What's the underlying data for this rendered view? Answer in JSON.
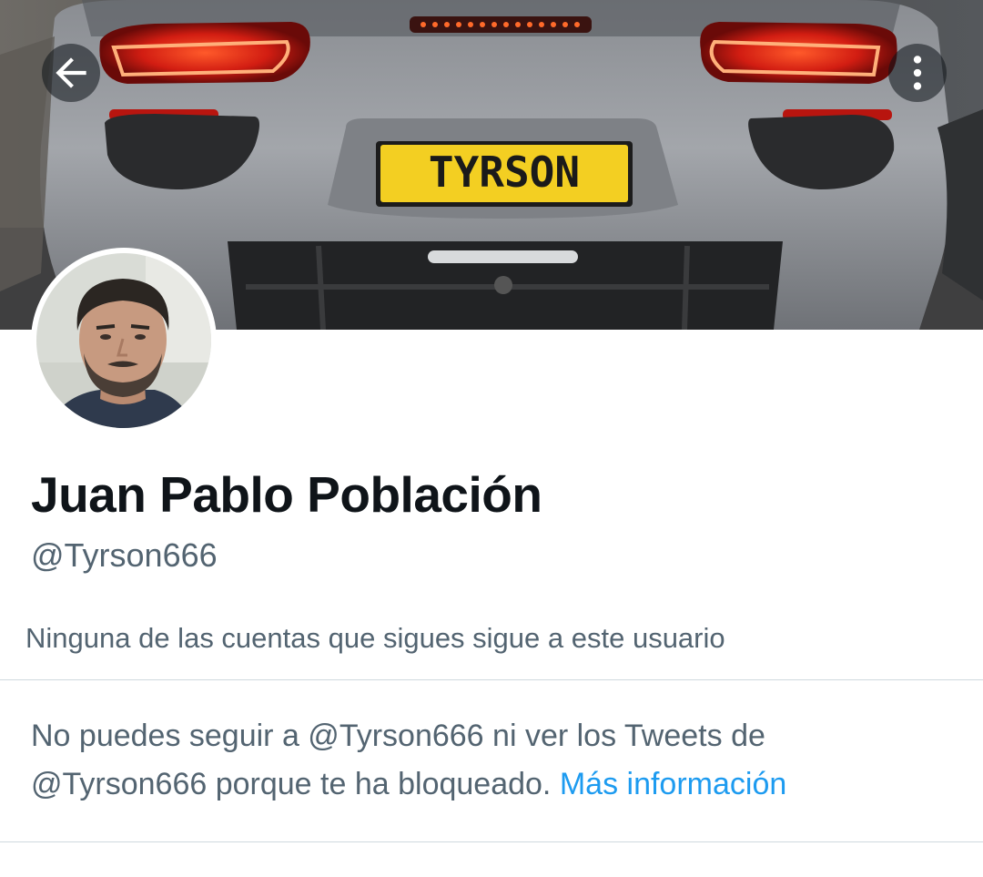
{
  "header": {
    "back_icon": "arrow-left-icon",
    "more_icon": "vertical-ellipsis-icon"
  },
  "banner": {
    "plate_text": "TYRSON"
  },
  "profile": {
    "display_name": "Juan Pablo Población",
    "handle": "@Tyrson666",
    "followers_note": "Ninguna de las cuentas que sigues sigue a este usuario"
  },
  "blocked": {
    "line1": "No puedes seguir a @Tyrson666 ni ver los Tweets de",
    "line2": "@Tyrson666 porque te ha bloqueado.",
    "link_label": "Más información"
  },
  "colors": {
    "primary_text": "#0f1419",
    "secondary_text": "#536471",
    "link": "#1d9bf0",
    "divider": "#cfd9de"
  }
}
